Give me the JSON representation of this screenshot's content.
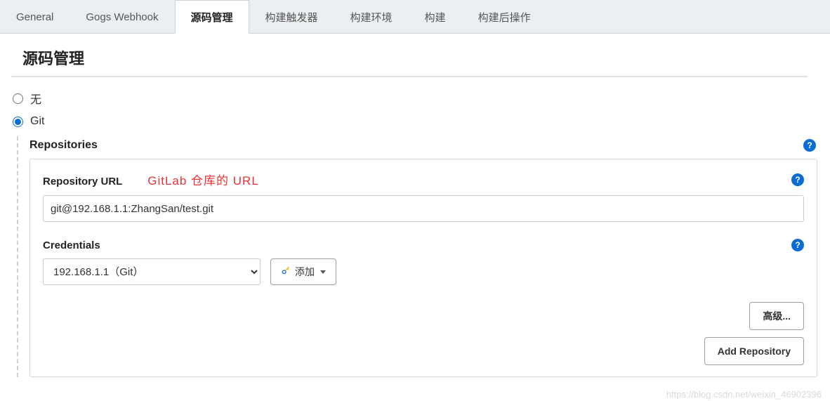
{
  "tabs": {
    "general": "General",
    "gogs": "Gogs Webhook",
    "scm": "源码管理",
    "trigger": "构建触发器",
    "env": "构建环境",
    "build": "构建",
    "post": "构建后操作"
  },
  "section_title": "源码管理",
  "scm_options": {
    "none": "无",
    "git": "Git"
  },
  "repositories_label": "Repositories",
  "repo_url": {
    "label": "Repository URL",
    "annotation": "GitLab  仓库的 URL",
    "value": "git@192.168.1.1:ZhangSan/test.git"
  },
  "credentials": {
    "label": "Credentials",
    "selected": "192.168.1.1（Git）",
    "add_label": "添加"
  },
  "buttons": {
    "advanced": "高级...",
    "add_repo": "Add Repository"
  },
  "help_glyph": "?",
  "watermark": "https://blog.csdn.net/weixin_46902396"
}
